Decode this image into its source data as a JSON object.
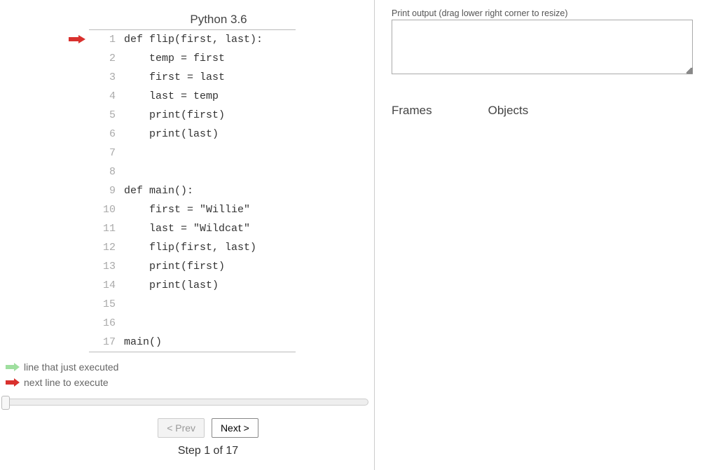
{
  "lang_title": "Python 3.6",
  "code_lines": [
    "def flip(first, last):",
    "    temp = first",
    "    first = last",
    "    last = temp",
    "    print(first)",
    "    print(last)",
    "",
    "",
    "def main():",
    "    first = \"Willie\"",
    "    last = \"Wildcat\"",
    "    flip(first, last)",
    "    print(first)",
    "    print(last)",
    "",
    "",
    "main()"
  ],
  "next_line_index": 0,
  "legend": {
    "just_executed": "line that just executed",
    "next_line": "next line to execute"
  },
  "buttons": {
    "prev": "< Prev",
    "next": "Next >"
  },
  "step_text": "Step 1 of 17",
  "output": {
    "label": "Print output (drag lower right corner to resize)",
    "value": ""
  },
  "vis": {
    "frames": "Frames",
    "objects": "Objects"
  }
}
